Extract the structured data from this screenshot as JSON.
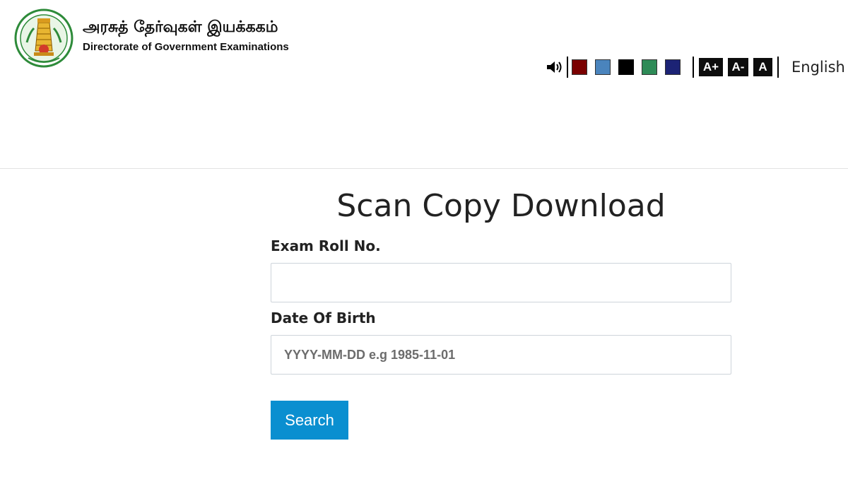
{
  "header": {
    "title_tamil": "அரசுத் தேர்வுகள் இயக்ககம்",
    "title_english": "Directorate of Government Examinations",
    "logo_icon": "tamil-nadu-emblem-icon"
  },
  "accessibility": {
    "speaker_icon": "speaker-icon",
    "themes": [
      {
        "name": "maroon",
        "color": "#7a0000"
      },
      {
        "name": "steel-blue",
        "color": "#4a84bd"
      },
      {
        "name": "black",
        "color": "#000000"
      },
      {
        "name": "green",
        "color": "#2e8b57"
      },
      {
        "name": "navy",
        "color": "#1c2375"
      }
    ],
    "font_increase": "A+",
    "font_decrease": "A-",
    "font_reset": "A",
    "language": "English"
  },
  "form": {
    "title": "Scan Copy Download",
    "roll_label": "Exam Roll No.",
    "roll_value": "",
    "roll_placeholder": "",
    "dob_label": "Date Of Birth",
    "dob_value": "",
    "dob_placeholder": "YYYY-MM-DD e.g 1985-11-01",
    "search_label": "Search"
  },
  "colors": {
    "primary_button": "#0a8fd0"
  }
}
